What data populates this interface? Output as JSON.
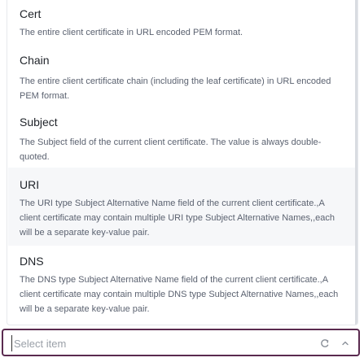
{
  "options": [
    {
      "title": "Cert",
      "description": "The entire client certificate in URL encoded PEM format."
    },
    {
      "title": "Chain",
      "description": "The entire client certificate chain (including the leaf certificate) in URL encoded PEM format."
    },
    {
      "title": "Subject",
      "description": "The Subject field of the current client certificate. The value is always double-quoted."
    },
    {
      "title": "URI",
      "description": "The URI type Subject Alternative Name field of the current client certificate.,A client certificate may contain multiple URI type Subject Alternative Names,,each will be a separate key-value pair."
    },
    {
      "title": "DNS",
      "description": "The DNS type Subject Alternative Name field of the current client certificate.,A client certificate may contain multiple DNS type Subject Alternative Names,,each will be a separate key-value pair."
    }
  ],
  "select": {
    "placeholder": "Select item",
    "value": "",
    "clear_icon": "clear-icon",
    "caret_icon": "chevron-up-icon"
  },
  "colors": {
    "focus_border": "#5a2a4f",
    "highlight_bg": "#f6f7f9"
  }
}
